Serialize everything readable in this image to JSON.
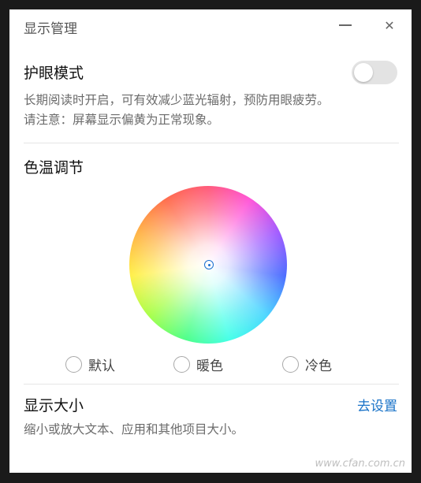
{
  "window": {
    "title": "显示管理",
    "close_glyph": "✕"
  },
  "eye_protection": {
    "title": "护眼模式",
    "enabled": false,
    "desc_line1": "长期阅读时开启，可有效减少蓝光辐射，预防用眼疲劳。",
    "desc_line2": "请注意：屏幕显示偏黄为正常现象。"
  },
  "color_temp": {
    "title": "色温调节",
    "options": [
      {
        "label": "默认",
        "selected": false
      },
      {
        "label": "暖色",
        "selected": false
      },
      {
        "label": "冷色",
        "selected": false
      }
    ]
  },
  "display_size": {
    "title": "显示大小",
    "link_label": "去设置",
    "desc": "缩小或放大文本、应用和其他项目大小。"
  },
  "watermark": "www.cfan.com.cn",
  "colors": {
    "accent": "#1a73c8",
    "toggle_off": "#e3e3e3"
  },
  "icons": [
    "minimize-icon",
    "close-icon",
    "color-wheel-marker-icon"
  ]
}
